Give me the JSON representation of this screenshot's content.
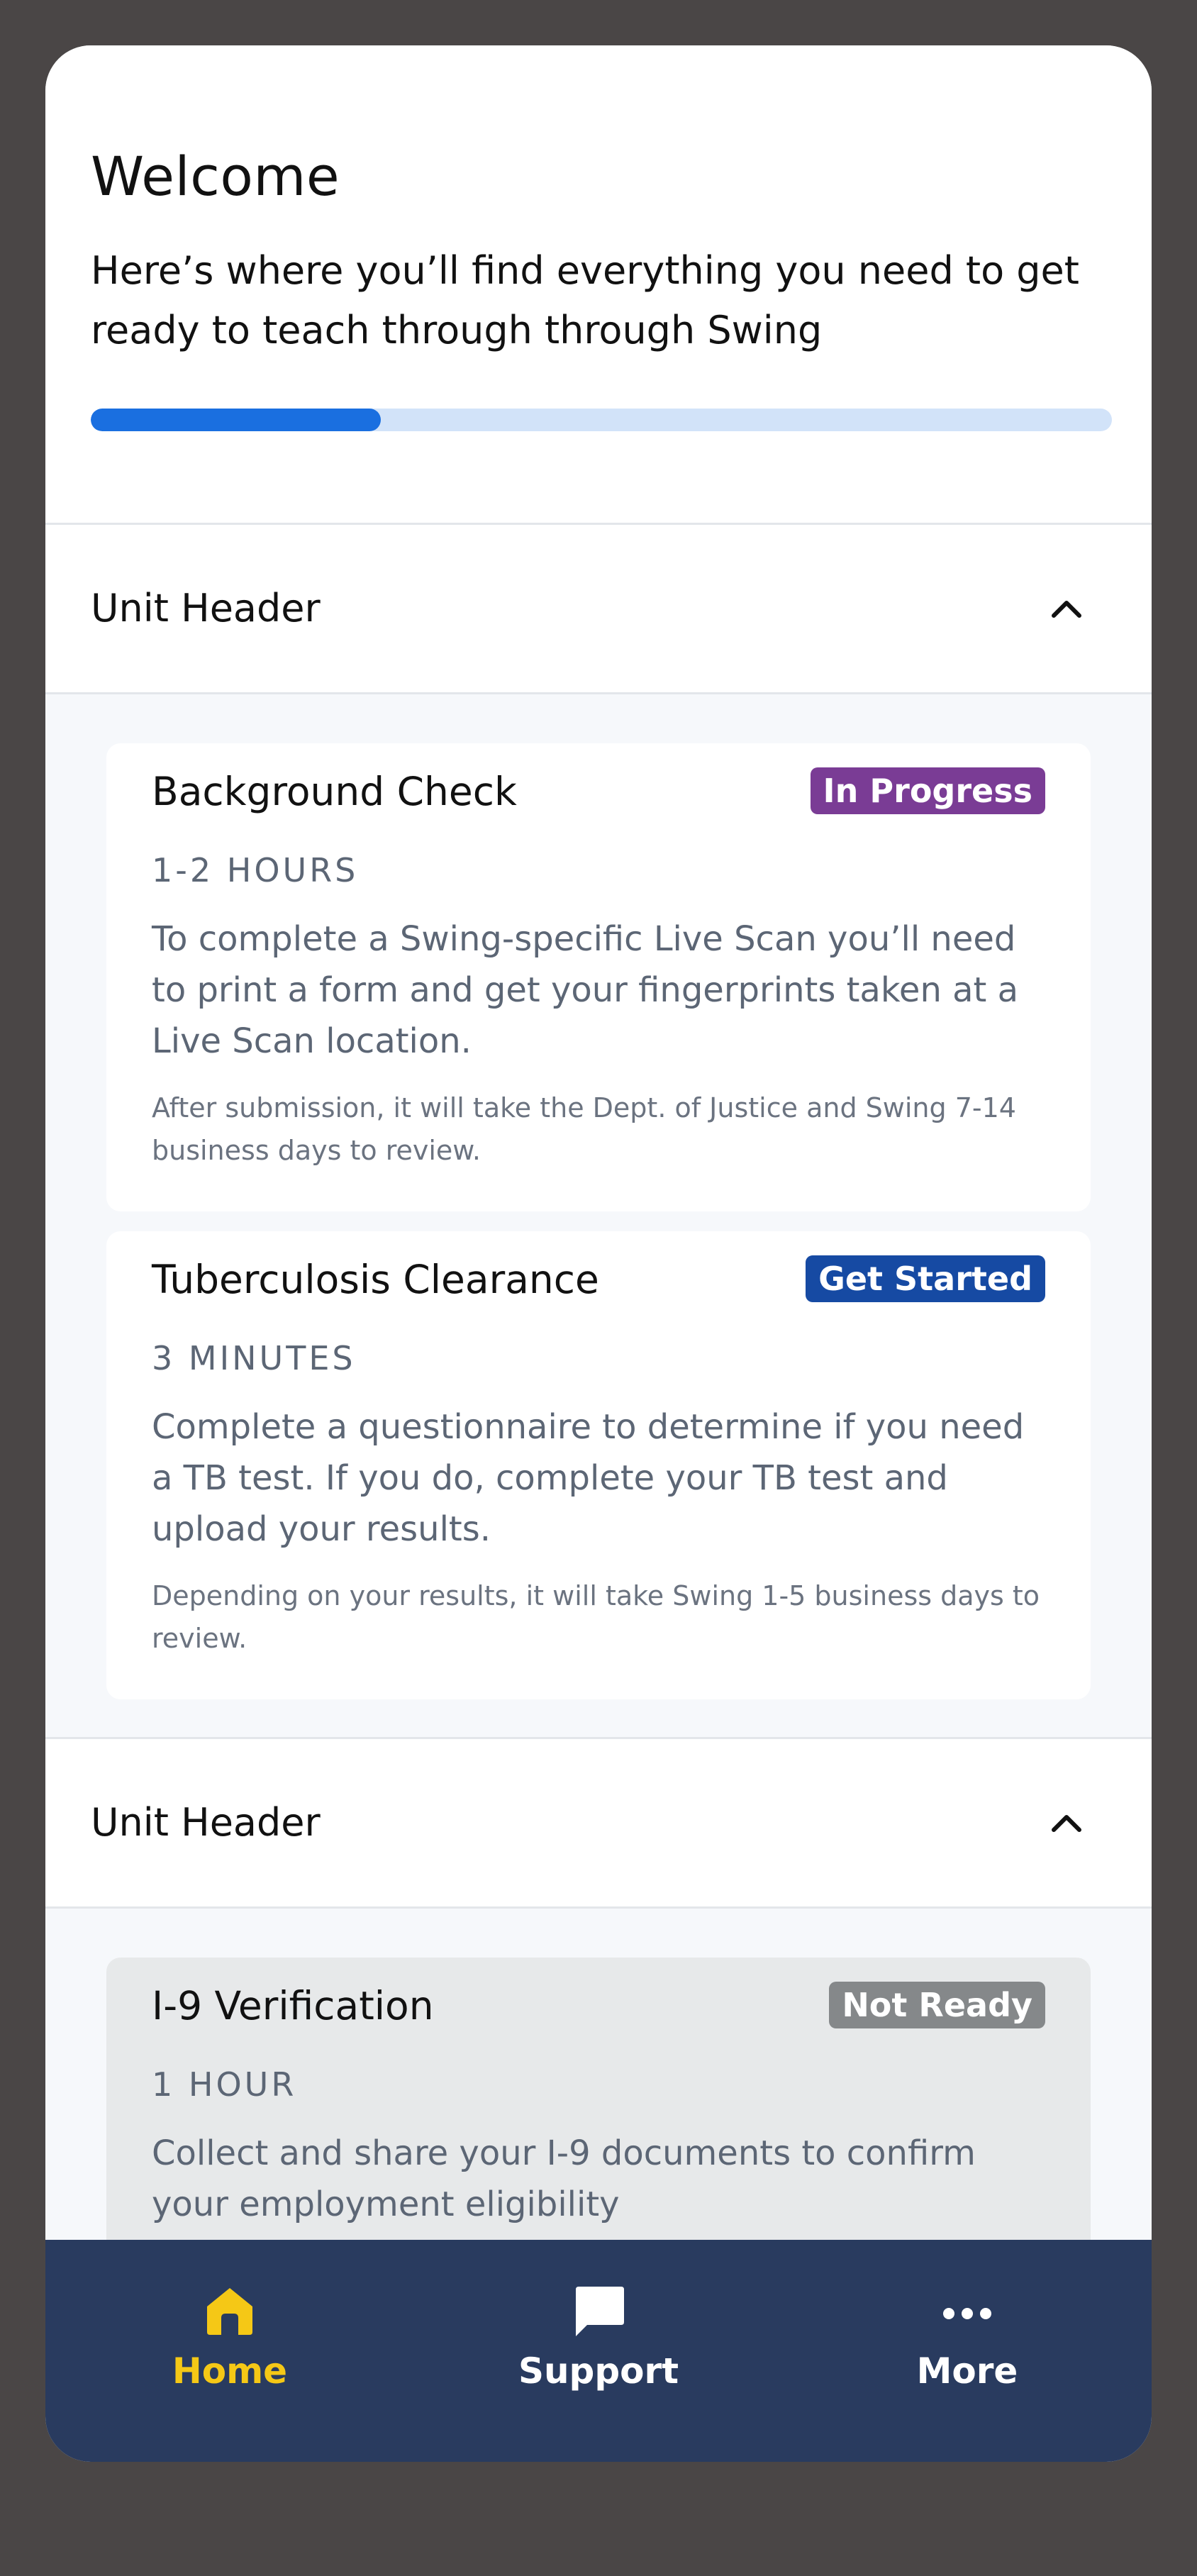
{
  "welcome": {
    "title": "Welcome",
    "subtitle": "Here’s where you’ll find everything you need to get ready to teach through through Swing",
    "progress_fraction": 0.284
  },
  "units": [
    {
      "header": "Unit Header",
      "expanded": true,
      "cards": [
        {
          "title": "Background Check",
          "status": "In Progress",
          "status_color": "#7a3c95",
          "duration": "1-2 HOURS",
          "description": "To complete a Swing-specific Live Scan you’ll need to print a form and get your fingerprints taken at a Live Scan location.",
          "note": "After submission, it will take the Dept. of Justice and Swing 7-14 business days to review."
        },
        {
          "title": "Tuberculosis Clearance",
          "status": "Get Started",
          "status_color": "#164aa3",
          "duration": "3 MINUTES",
          "description": "Complete a questionnaire to determine if you need a TB test. If you do, complete your TB test and upload your results.",
          "note": "Depending on your results, it will take Swing 1-5 business days to review."
        }
      ]
    },
    {
      "header": "Unit Header",
      "expanded": true,
      "cards": [
        {
          "title": "I-9 Verification",
          "status": "Not Ready",
          "status_color": "#85888a",
          "duration": "1 HOUR",
          "description": "Collect and share your I-9 documents to confirm your employment eligibility"
        }
      ]
    }
  ],
  "tabbar": {
    "tabs": [
      {
        "label": "Home",
        "icon": "home-icon",
        "active": true
      },
      {
        "label": "Support",
        "icon": "chat-bubble-icon",
        "active": false
      },
      {
        "label": "More",
        "icon": "more-dots-icon",
        "active": false
      }
    ],
    "background": "#293b5f",
    "active_color": "#f5c816"
  }
}
